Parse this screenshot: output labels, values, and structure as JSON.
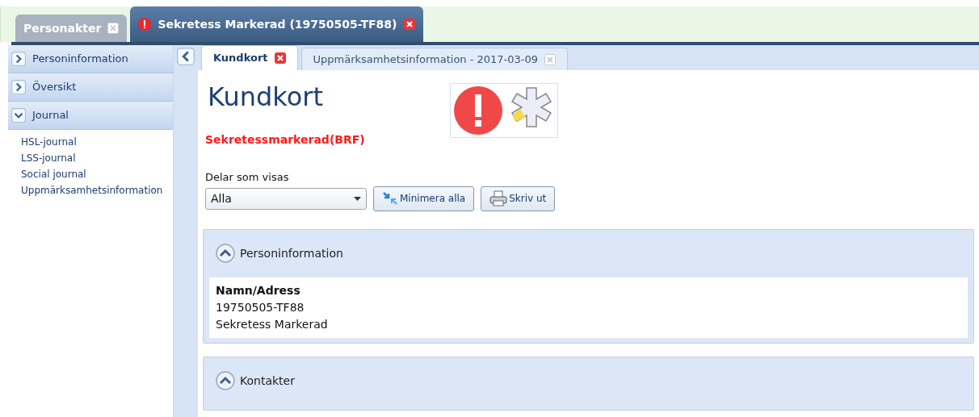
{
  "top_tabs": [
    {
      "label": "Personakter",
      "selected": false,
      "alert": false
    },
    {
      "label": "Sekretess Markerad (19750505-TF88)",
      "selected": true,
      "alert": true
    }
  ],
  "sidebar": {
    "sections": [
      {
        "label": "Personinformation",
        "expanded": false
      },
      {
        "label": "Översikt",
        "expanded": false
      },
      {
        "label": "Journal",
        "expanded": true,
        "items": [
          "HSL-journal",
          "LSS-journal",
          "Social journal",
          "Uppmärksamhetsinformation"
        ]
      }
    ]
  },
  "inner_tabs": [
    {
      "label": "Kundkort",
      "selected": true
    },
    {
      "label": "Uppmärksamhetsinformation - 2017-03-09",
      "selected": false
    }
  ],
  "page": {
    "title": "Kundkort",
    "warning": "Sekretessmarkerad(BRF)",
    "filter": {
      "label": "Delar som visas",
      "value": "Alla"
    },
    "buttons": [
      {
        "label": "Minimera alla",
        "kind": "minimize"
      },
      {
        "label": "Skriv ut",
        "kind": "print"
      }
    ],
    "panels": [
      {
        "title": "Personinformation",
        "expanded": true,
        "heading": "Namn/Adress",
        "lines": [
          "19750505-TF88",
          "Sekretess Markerad"
        ]
      },
      {
        "title": "Kontakter",
        "expanded": true
      }
    ]
  }
}
